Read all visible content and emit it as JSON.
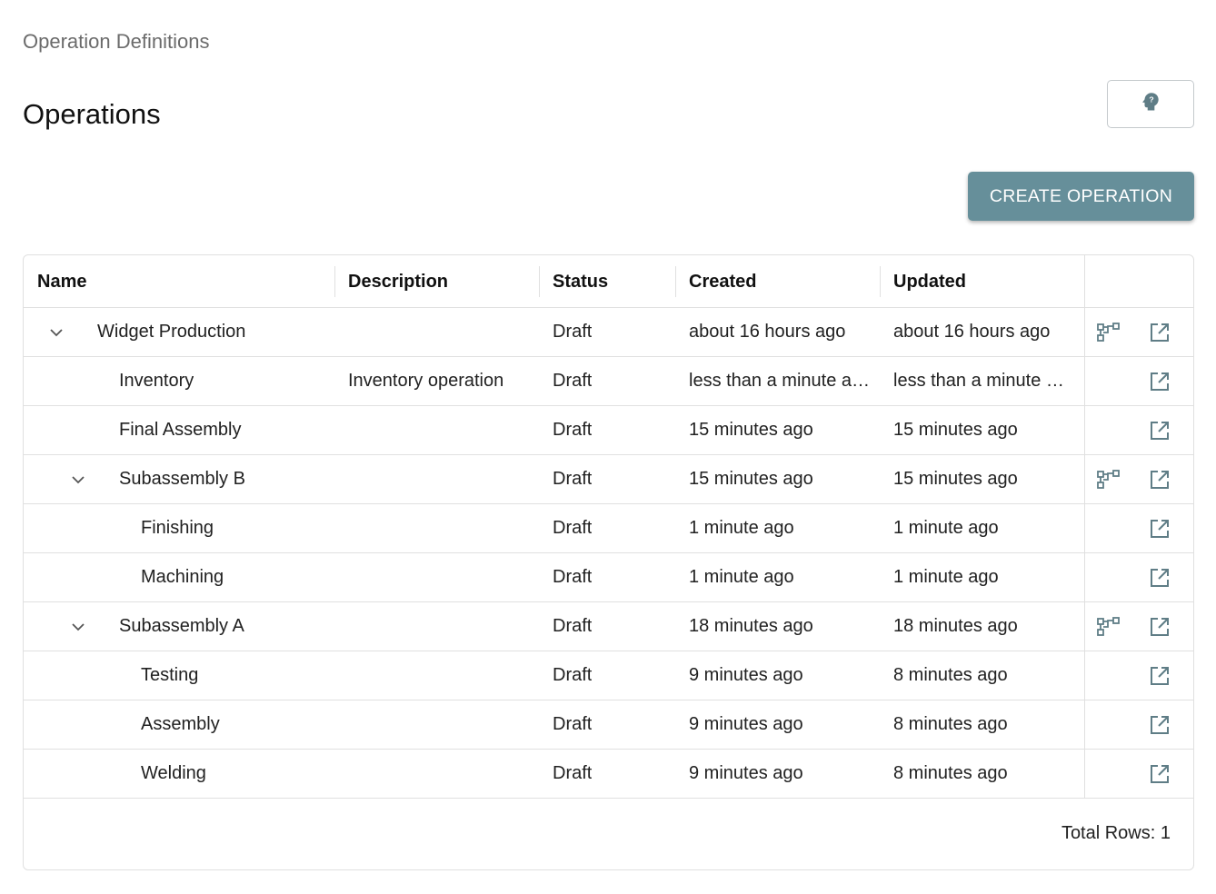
{
  "breadcrumb": "Operation Definitions",
  "title": "Operations",
  "help_button_icon": "help-head-icon",
  "create_button_label": "CREATE OPERATION",
  "columns": {
    "name": "Name",
    "description": "Description",
    "status": "Status",
    "created": "Created",
    "updated": "Updated"
  },
  "rows": [
    {
      "name": "Widget Production",
      "description": "",
      "status": "Draft",
      "created": "about 16 hours ago",
      "updated": "about 16 hours ago",
      "expanded": true,
      "has_flow": true
    },
    {
      "name": "Inventory",
      "description": "Inventory operation",
      "status": "Draft",
      "created": "less than a minute a…",
      "updated": "less than a minute a…",
      "has_flow": false
    },
    {
      "name": "Final Assembly",
      "description": "",
      "status": "Draft",
      "created": "15 minutes ago",
      "updated": "15 minutes ago",
      "has_flow": false
    },
    {
      "name": "Subassembly B",
      "description": "",
      "status": "Draft",
      "created": "15 minutes ago",
      "updated": "15 minutes ago",
      "expanded": true,
      "has_flow": true
    },
    {
      "name": "Finishing",
      "description": "",
      "status": "Draft",
      "created": "1 minute ago",
      "updated": "1 minute ago",
      "has_flow": false
    },
    {
      "name": "Machining",
      "description": "",
      "status": "Draft",
      "created": "1 minute ago",
      "updated": "1 minute ago",
      "has_flow": false
    },
    {
      "name": "Subassembly A",
      "description": "",
      "status": "Draft",
      "created": "18 minutes ago",
      "updated": "18 minutes ago",
      "expanded": true,
      "has_flow": true
    },
    {
      "name": "Testing",
      "description": "",
      "status": "Draft",
      "created": "9 minutes ago",
      "updated": "8 minutes ago",
      "has_flow": false
    },
    {
      "name": "Assembly",
      "description": "",
      "status": "Draft",
      "created": "9 minutes ago",
      "updated": "8 minutes ago",
      "has_flow": false
    },
    {
      "name": "Welding",
      "description": "",
      "status": "Draft",
      "created": "9 minutes ago",
      "updated": "8 minutes ago",
      "has_flow": false
    }
  ],
  "total_rows_text": "Total Rows: 1",
  "colors": {
    "primary": "#668f9a",
    "icon": "#5f7d86",
    "border": "#e0e0e0"
  }
}
